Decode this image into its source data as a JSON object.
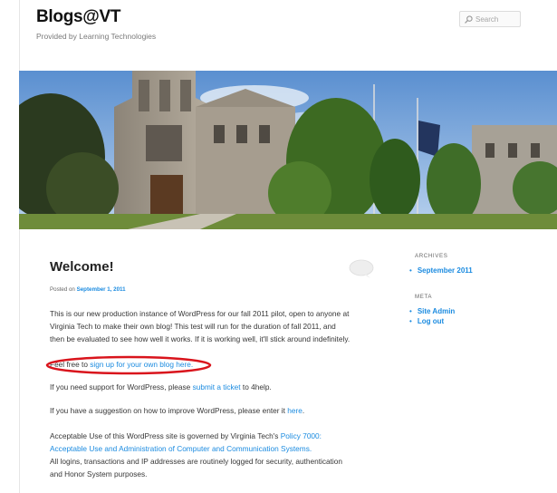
{
  "site": {
    "title": "Blogs@VT",
    "description": "Provided by Learning Technologies"
  },
  "search": {
    "placeholder": "Search"
  },
  "post": {
    "title": "Welcome!",
    "posted_prefix": "Posted on ",
    "posted_date": "September 1, 2011",
    "p1_line1": "This is our new production instance of WordPress for our fall 2011 pilot, open to anyone at",
    "p1_line2": "Virginia Tech to make their own blog!  This test will run for the duration of fall 2011, and",
    "p1_line3": "then be evaluated to see how well it works.  If it is working well, it'll stick around indefinitely.",
    "p2_text": "Feel free to ",
    "p2_link": "sign up for your own blog here.",
    "p3_text": "If you need support for WordPress, please ",
    "p3_link": "submit a ticket",
    "p3_suffix": " to 4help.",
    "p4_text": "If you have a suggestion on how to improve WordPress, please enter it ",
    "p4_link": "here",
    "p4_suffix": ".",
    "p5_text": "Acceptable Use of this WordPress site is governed by Virginia Tech's ",
    "p5_link1": "Policy 7000:",
    "p5_link2": "Acceptable Use and Administration of Computer and Communication Systems.",
    "p5_line3": "All logins, transactions and IP addresses are routinely logged for security, authentication",
    "p5_line4": "and Honor System purposes."
  },
  "sidebar": {
    "archives_title": "ARCHIVES",
    "archives": [
      "September 2011"
    ],
    "meta_title": "META",
    "meta": [
      "Site Admin",
      "Log out"
    ]
  },
  "colors": {
    "link": "#1b8be0",
    "annotation": "#d9141c"
  }
}
